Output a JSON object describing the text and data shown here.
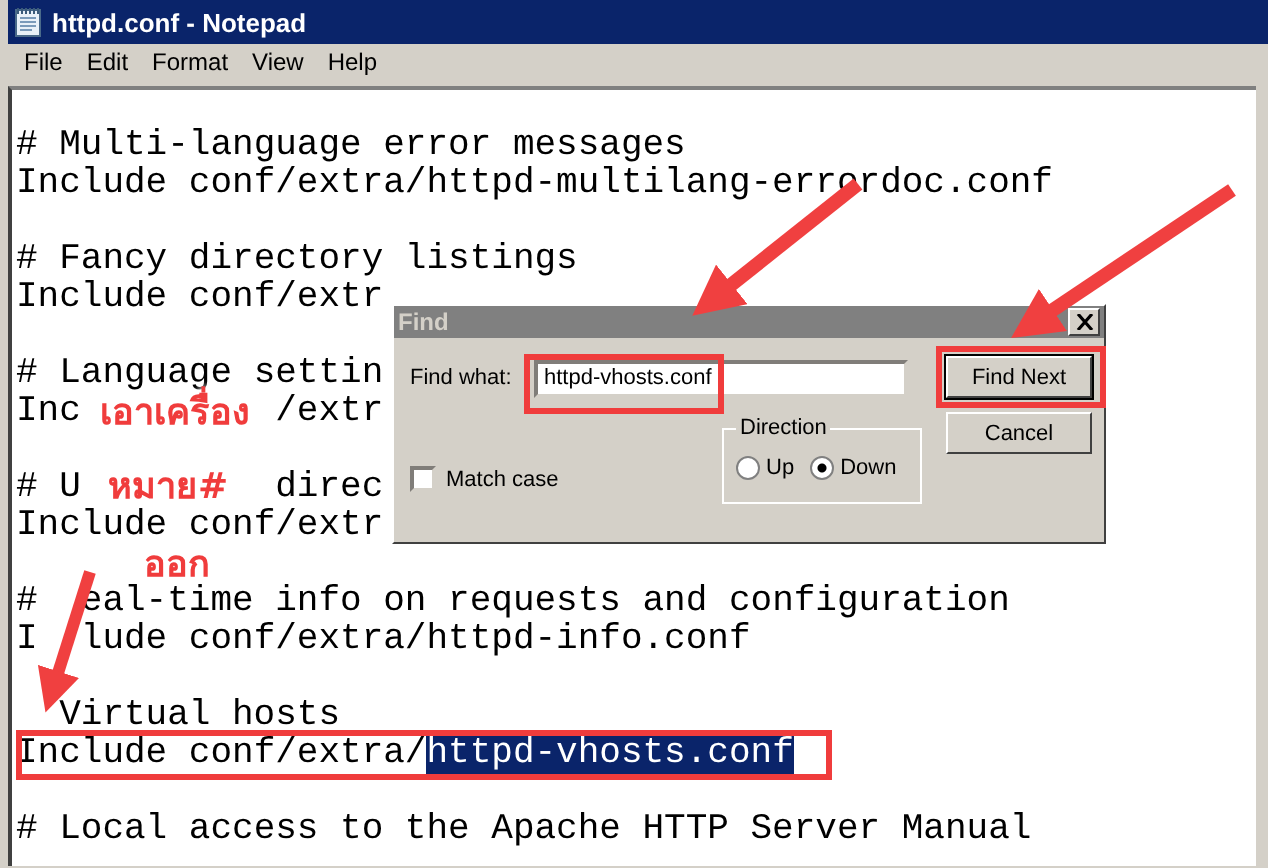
{
  "window": {
    "title": "httpd.conf - Notepad"
  },
  "menu": [
    "File",
    "Edit",
    "Format",
    "View",
    "Help"
  ],
  "editor": {
    "lines": [
      {
        "kind": "blank"
      },
      {
        "kind": "text",
        "parts": [
          "# Multi-language error messages"
        ]
      },
      {
        "kind": "text",
        "parts": [
          "Include conf/extra/httpd-multilang-errordoc.conf"
        ]
      },
      {
        "kind": "blank"
      },
      {
        "kind": "text",
        "parts": [
          "# Fancy directory listings"
        ]
      },
      {
        "kind": "text",
        "parts": [
          "Include conf/extr"
        ]
      },
      {
        "kind": "blank"
      },
      {
        "kind": "text",
        "parts": [
          "# Language settin"
        ]
      },
      {
        "kind": "text",
        "parts": [
          "Inc",
          "/extr"
        ]
      },
      {
        "kind": "blank"
      },
      {
        "kind": "text",
        "parts": [
          "# U",
          "direc"
        ]
      },
      {
        "kind": "text",
        "parts": [
          "Include conf/extr"
        ]
      },
      {
        "kind": "blank"
      },
      {
        "kind": "text",
        "parts": [
          "#",
          "eal-time info on requests and configuration"
        ]
      },
      {
        "kind": "text",
        "parts": [
          "I",
          "lude conf/extra/httpd-info.conf"
        ]
      },
      {
        "kind": "blank"
      },
      {
        "kind": "text",
        "parts": [
          "Virtual hosts"
        ]
      },
      {
        "kind": "text",
        "parts": [
          "Include conf/extra/"
        ],
        "selection": "httpd-vhosts.conf"
      },
      {
        "kind": "blank"
      },
      {
        "kind": "text",
        "parts": [
          "# Local access to the Apache HTTP Server Manual"
        ]
      }
    ]
  },
  "find_dialog": {
    "title": "Find",
    "find_label": "Find what:",
    "find_value": "httpd-vhosts.conf",
    "buttons": [
      {
        "label": "Find Next",
        "default": true
      },
      {
        "label": "Cancel",
        "default": false
      }
    ],
    "match_case": {
      "label": "Match case",
      "checked": false
    },
    "direction": {
      "label": "Direction",
      "options": [
        {
          "label": "Up",
          "selected": false
        },
        {
          "label": "Down",
          "selected": true
        }
      ]
    }
  },
  "annotation": {
    "lines": [
      "เอาเครื่อง",
      "หมาย#",
      "ออก"
    ]
  }
}
